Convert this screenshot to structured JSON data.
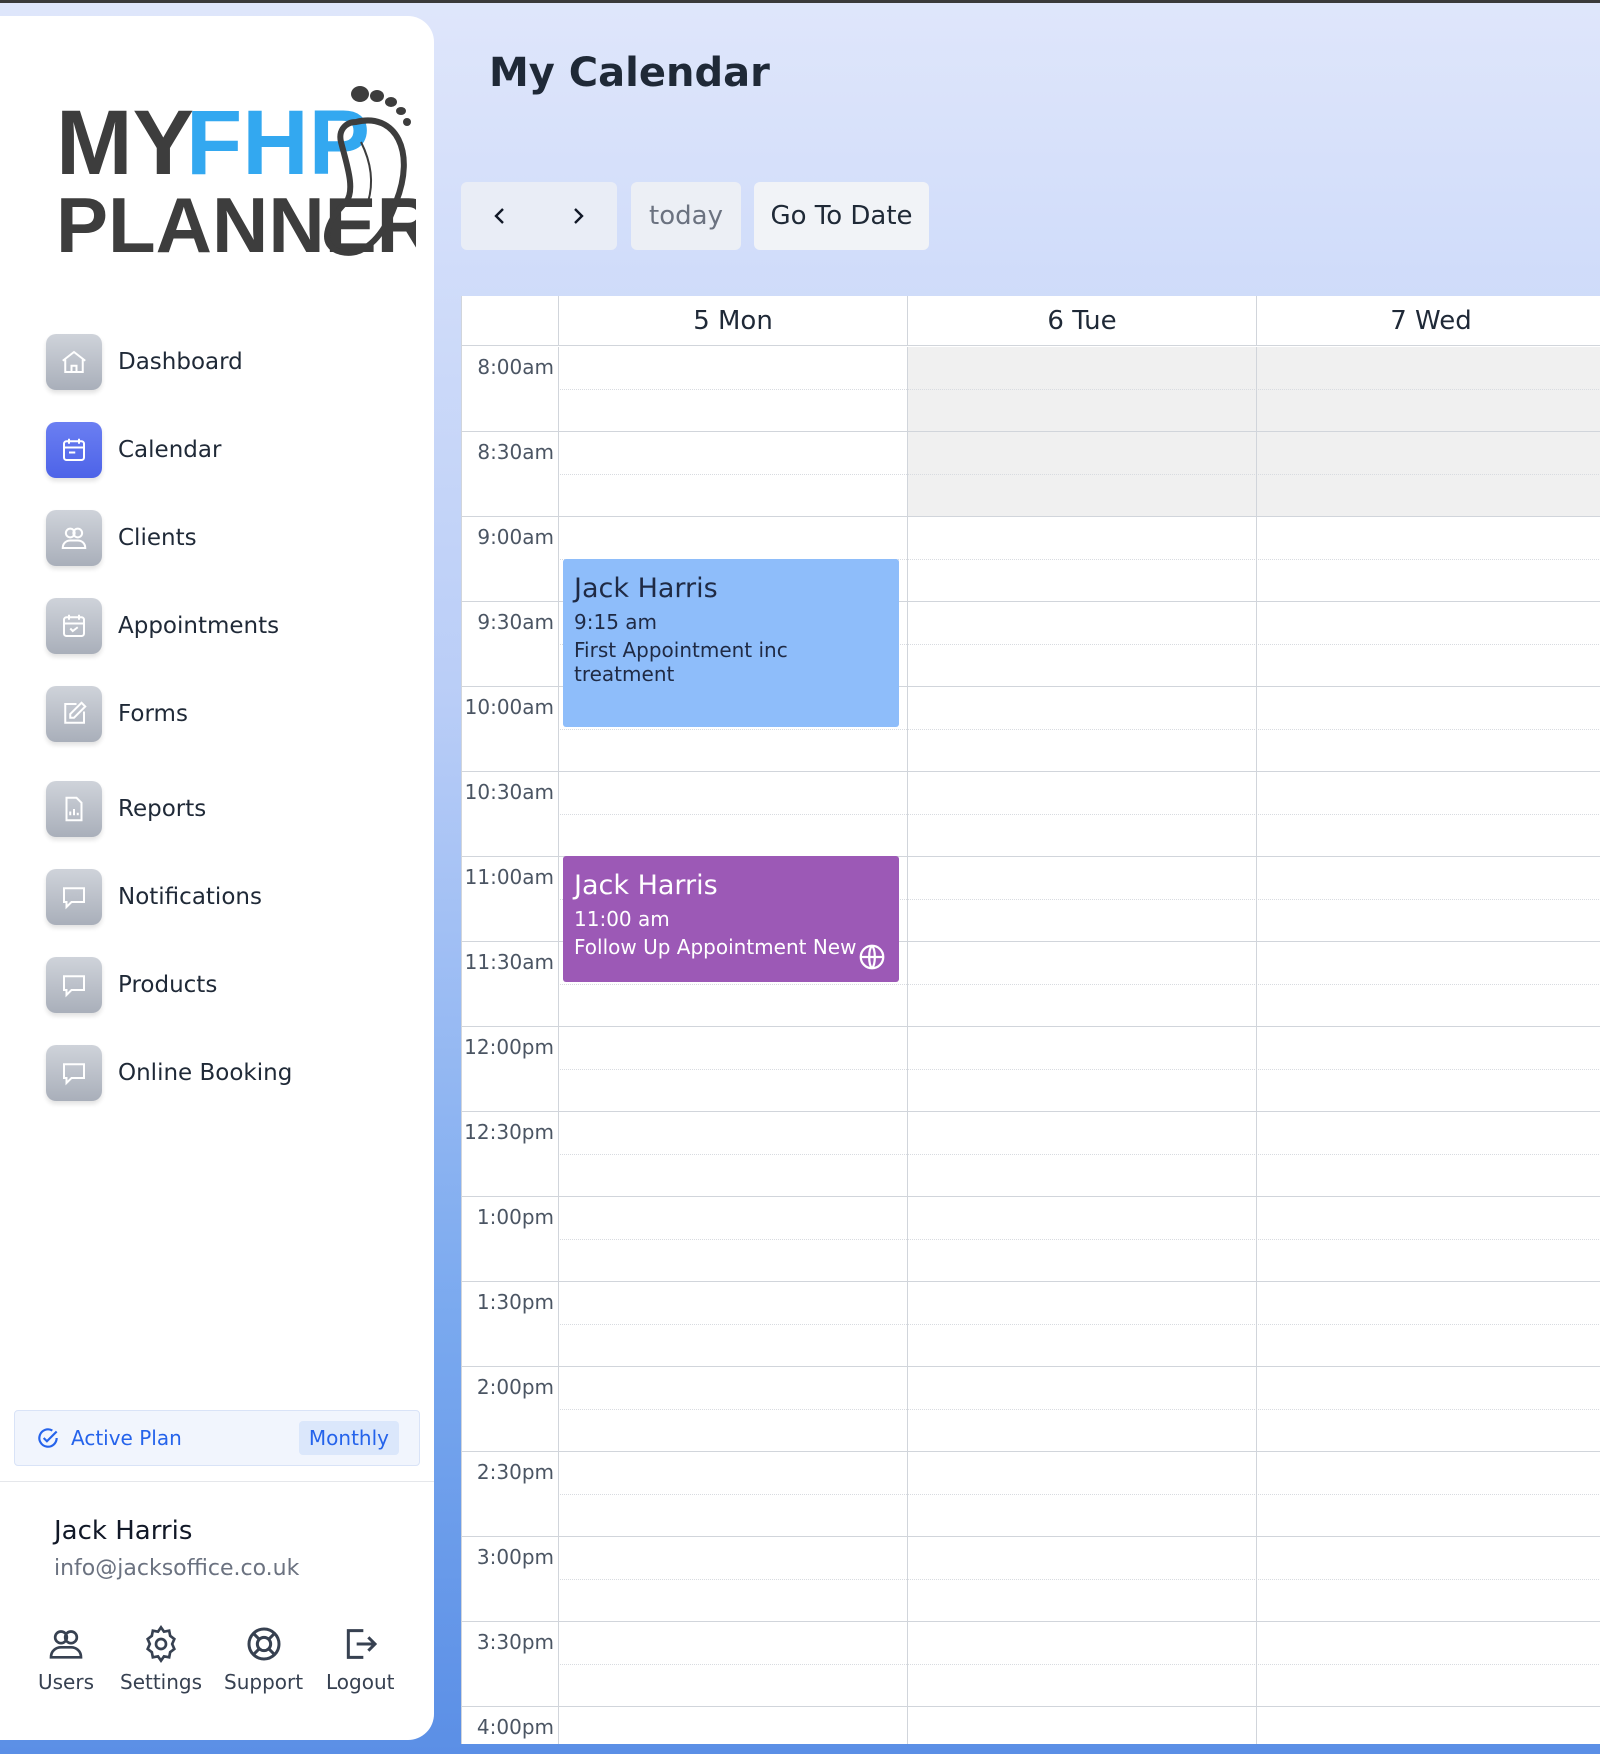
{
  "app": {
    "logo": {
      "line1_a": "MY",
      "line1_b": "FHP",
      "line2": "PLANNER"
    },
    "page_title": "My Calendar"
  },
  "sidebar": {
    "items": [
      {
        "label": "Dashboard",
        "icon": "home-icon"
      },
      {
        "label": "Calendar",
        "icon": "calendar-icon",
        "active": true
      },
      {
        "label": "Clients",
        "icon": "users-icon"
      },
      {
        "label": "Appointments",
        "icon": "calendar-check-icon"
      },
      {
        "label": "Forms",
        "icon": "edit-icon"
      },
      {
        "label": "Reports",
        "icon": "report-icon"
      },
      {
        "label": "Notifications",
        "icon": "message-icon"
      },
      {
        "label": "Products",
        "icon": "message-icon"
      },
      {
        "label": "Online Booking",
        "icon": "message-icon"
      }
    ],
    "plan": {
      "label": "Active Plan",
      "badge": "Monthly"
    },
    "user": {
      "name": "Jack Harris",
      "email": "info@jacksoffice.co.uk"
    },
    "actions": [
      {
        "label": "Users",
        "icon": "users-icon"
      },
      {
        "label": "Settings",
        "icon": "gear-icon"
      },
      {
        "label": "Support",
        "icon": "lifebuoy-icon"
      },
      {
        "label": "Logout",
        "icon": "logout-icon"
      }
    ]
  },
  "toolbar": {
    "prev_icon": "chevron-left-icon",
    "next_icon": "chevron-right-icon",
    "today_label": "today",
    "goto_label": "Go To Date"
  },
  "calendar": {
    "days": [
      "5 Mon",
      "6 Tue",
      "7 Wed"
    ],
    "times": [
      "8:00am",
      "8:30am",
      "9:00am",
      "9:30am",
      "10:00am",
      "10:30am",
      "11:00am",
      "11:30am",
      "12:00pm",
      "12:30pm",
      "1:00pm",
      "1:30pm",
      "2:00pm",
      "2:30pm",
      "3:00pm",
      "3:30pm",
      "4:00pm"
    ],
    "events": [
      {
        "title": "Jack Harris",
        "time": "9:15 am",
        "description": "First Appointment inc treatment",
        "day": "5 Mon",
        "color": "#8ebdfa"
      },
      {
        "title": "Jack Harris",
        "time": "11:00 am",
        "description": "Follow Up Appointment New",
        "day": "5 Mon",
        "color": "#9c59b6",
        "icon": "globe-icon"
      }
    ]
  },
  "colors": {
    "accent": "#4d63e8",
    "brand_blue": "#33a8f0",
    "logo_gray": "#3d3d3d"
  }
}
